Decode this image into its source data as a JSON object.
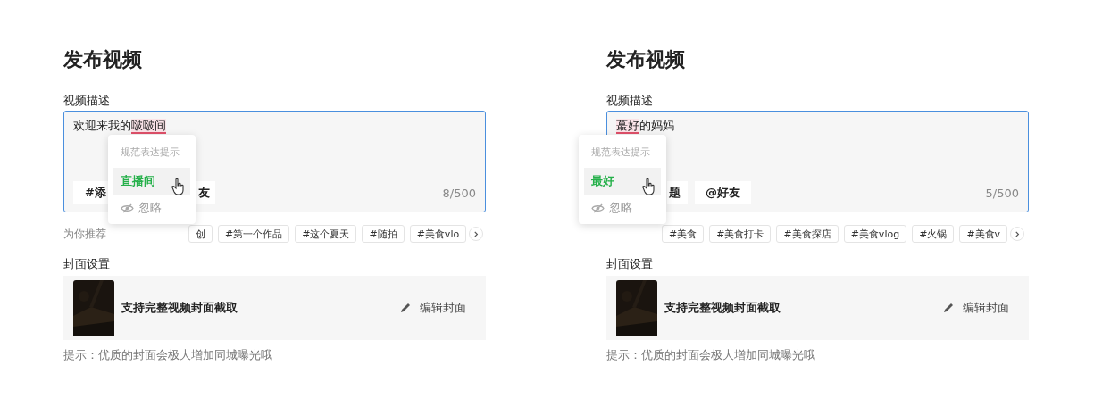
{
  "panels": [
    {
      "title": "发布视频",
      "description_label": "视频描述",
      "text": [
        {
          "text": "欢迎来我的",
          "flagged": false
        },
        {
          "text": "啵啵间",
          "flagged": true
        }
      ],
      "popup": {
        "heading": "规范表达提示",
        "suggestion": "直播间",
        "ignore": "忽略"
      },
      "chips": [
        "#添",
        "友"
      ],
      "counter": "8/500",
      "recommend_label": "为你推荐",
      "tags": [
        "创",
        "#第一个作品",
        "#这个夏天",
        "#随拍",
        "#美食vlo"
      ],
      "cover_label": "封面设置",
      "cover_text": "支持完整视频封面截取",
      "edit_cover": "编辑封面",
      "hint": "提示：优质的封面会极大增加同城曝光哦"
    },
    {
      "title": "发布视频",
      "description_label": "视频描述",
      "text": [
        {
          "text": "蕞好",
          "flagged": true
        },
        {
          "text": "的妈妈",
          "flagged": false
        }
      ],
      "popup": {
        "heading": "规范表达提示",
        "suggestion": "最好",
        "ignore": "忽略"
      },
      "chips": [
        "题",
        "@好友"
      ],
      "counter": "5/500",
      "tags": [
        "#美食",
        "#美食打卡",
        "#美食探店",
        "#美食vlog",
        "#火锅",
        "#美食v"
      ],
      "cover_label": "封面设置",
      "cover_text": "支持完整视频封面截取",
      "edit_cover": "编辑封面",
      "hint": "提示：优质的封面会极大增加同城曝光哦"
    }
  ]
}
